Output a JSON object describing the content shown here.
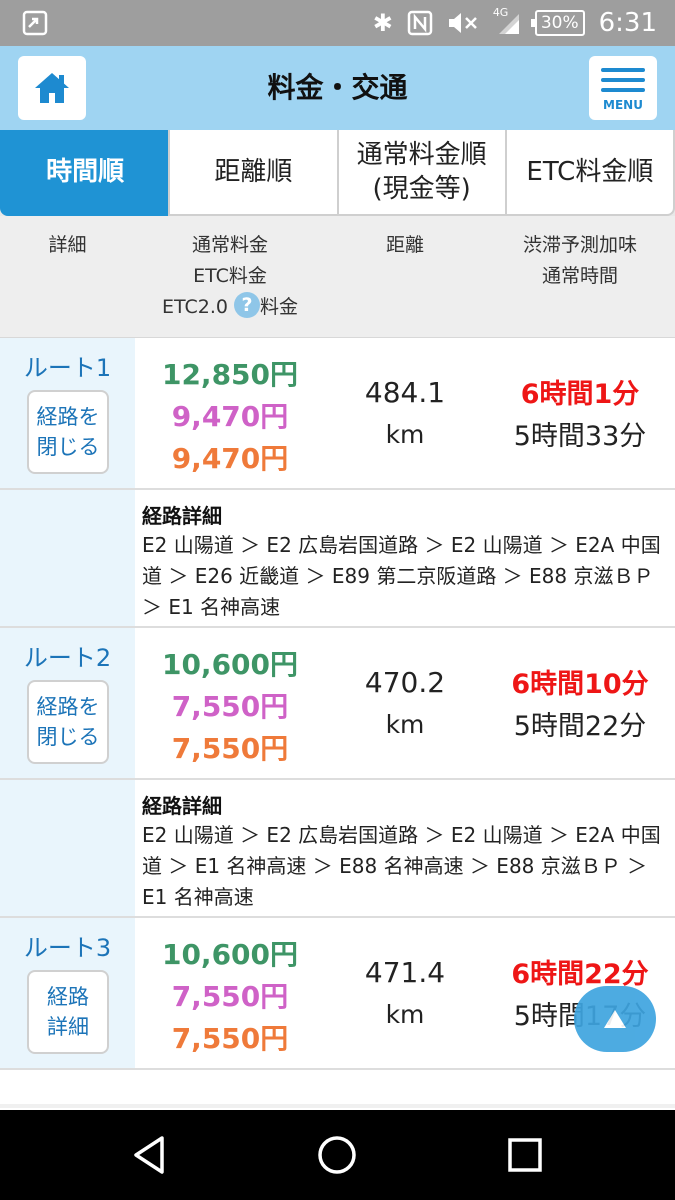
{
  "status_bar": {
    "network": "4G",
    "battery": "30%",
    "time": "6:31",
    "icons": [
      "screen-share-icon",
      "bluetooth-icon",
      "nfc-icon",
      "mute-icon",
      "signal-icon",
      "battery-icon"
    ]
  },
  "header": {
    "title": "料金・交通",
    "menu_label": "MENU"
  },
  "tabs": [
    {
      "label": "時間順",
      "active": true
    },
    {
      "label": "距離順",
      "active": false
    },
    {
      "label": "通常料金順\n(現金等)",
      "active": false
    },
    {
      "label": "ETC料金順",
      "active": false
    }
  ],
  "columns": {
    "detail": "詳細",
    "normal_fare": "通常料金",
    "etc_fare": "ETC料金",
    "etc2_prefix": "ETC2.0",
    "etc2_help": "?",
    "etc2_suffix": "料金",
    "distance": "距離",
    "predicted": "渋滞予測加味",
    "normal_time": "通常時間"
  },
  "routes": [
    {
      "name": "ルート1",
      "button": "経路を\n閉じる",
      "normal_fare": "12,850円",
      "etc_fare": "9,470円",
      "etc2_fare": "9,470円",
      "distance": "484.1",
      "unit": "km",
      "predicted_time": "6時間1分",
      "normal_time": "5時間33分",
      "detail_title": "経路詳細",
      "detail": "E2 山陽道 ＞ E2 広島岩国道路 ＞ E2 山陽道 ＞ E2A 中国道 ＞ E26 近畿道 ＞ E89 第二京阪道路 ＞ E88 京滋ＢＰ ＞ E1 名神高速"
    },
    {
      "name": "ルート2",
      "button": "経路を\n閉じる",
      "normal_fare": "10,600円",
      "etc_fare": "7,550円",
      "etc2_fare": "7,550円",
      "distance": "470.2",
      "unit": "km",
      "predicted_time": "6時間10分",
      "normal_time": "5時間22分",
      "detail_title": "経路詳細",
      "detail": "E2 山陽道 ＞ E2 広島岩国道路 ＞ E2 山陽道 ＞ E2A 中国道 ＞ E1 名神高速 ＞ E88 名神高速 ＞ E88 京滋ＢＰ ＞ E1 名神高速"
    },
    {
      "name": "ルート3",
      "button": "経路\n詳細",
      "normal_fare": "10,600円",
      "etc_fare": "7,550円",
      "etc2_fare": "7,550円",
      "distance": "471.4",
      "unit": "km",
      "predicted_time": "6時間22分",
      "normal_time": "5時間17分"
    }
  ],
  "colors": {
    "header_bg": "#9fd4f2",
    "tab_active": "#1f93d4",
    "normal_fare": "#3e9566",
    "etc_fare": "#cf62c7",
    "etc2_fare": "#ef7a3a",
    "predicted_time": "#ee1616"
  }
}
